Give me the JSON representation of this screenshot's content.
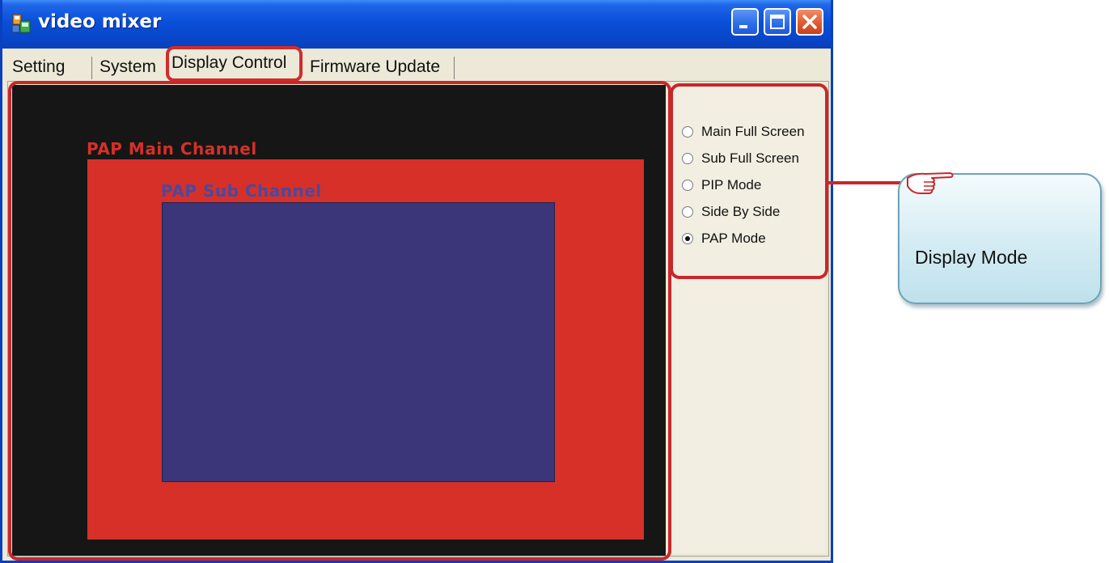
{
  "window": {
    "title": "video mixer",
    "controls": {
      "minimize": "minimize-button",
      "maximize": "maximize-button",
      "close": "close-button"
    }
  },
  "tabs": [
    {
      "label": "Setting",
      "active": false
    },
    {
      "label": "System",
      "active": false
    },
    {
      "label": "Display Control",
      "active": true
    },
    {
      "label": "Firmware Update",
      "active": false
    }
  ],
  "preview": {
    "main_label": "PAP Main Channel",
    "sub_label": "PAP Sub Channel"
  },
  "display_modes": [
    {
      "label": "Main Full Screen",
      "checked": false
    },
    {
      "label": "Sub Full Screen",
      "checked": false
    },
    {
      "label": "PIP Mode",
      "checked": false
    },
    {
      "label": "Side By Side",
      "checked": false
    },
    {
      "label": "PAP Mode",
      "checked": true
    }
  ],
  "callout": {
    "text": "Display Mode"
  },
  "colors": {
    "highlight": "#c9272b",
    "main_channel": "#d63028",
    "sub_channel": "#3a3679",
    "titlebar": "#0a4fd9",
    "callout": "#d4ecf3"
  }
}
